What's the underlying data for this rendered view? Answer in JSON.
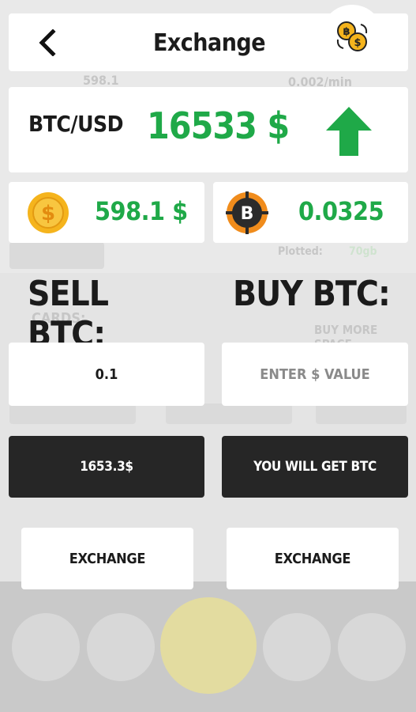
{
  "header": {
    "title": "Exchange",
    "back_icon": "chevron-left-icon",
    "exchange_icon": "coin-exchange-icon"
  },
  "rate": {
    "pair": "BTC/USD",
    "price": "16533 $",
    "trend": "up",
    "trend_color": "#1fa948"
  },
  "balances": {
    "usd_value": "598.1 $",
    "btc_value": "0.0325"
  },
  "sell": {
    "heading": "SELL BTC:",
    "input_value": "0.1",
    "result": "1653.3$",
    "button": "EXCHANGE"
  },
  "buy": {
    "heading": "BUY BTC:",
    "input_placeholder": "ENTER $ VALUE",
    "result": "YOU WILL GET BTC",
    "button": "EXCHANGE"
  },
  "background": {
    "ghost_cards_label": "CARDS:",
    "ghost_buy_space": "BUY MORE SPACE",
    "ghost_plotted": "Plotted:",
    "ghost_plotted_value": "70gb",
    "ghost_balance": "598.1",
    "ghost_rate": "0.002/min"
  },
  "colors": {
    "accent_green": "#1fa948",
    "dark_button": "#262626",
    "coin_gold": "#f5b41d"
  }
}
